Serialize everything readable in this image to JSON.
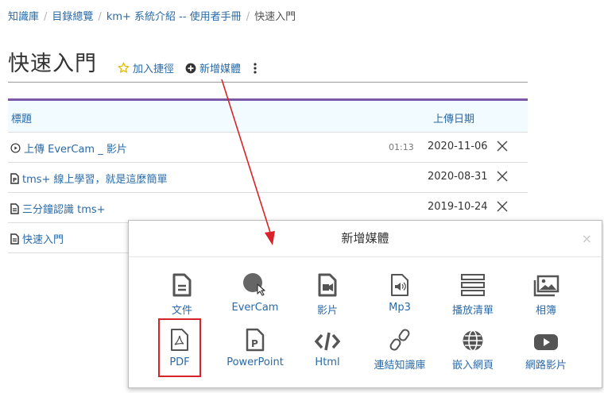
{
  "breadcrumb": {
    "items": [
      "知識庫",
      "目錄總覽",
      "km+ 系統介紹 -- 使用者手冊"
    ],
    "current": "快速入門",
    "separator": "/"
  },
  "page": {
    "title": "快速入門",
    "add_shortcut": "加入捷徑",
    "add_media": "新增媒體"
  },
  "table": {
    "headers": {
      "title": "標題",
      "date": "上傳日期"
    },
    "rows": [
      {
        "icon": "play-circle-icon",
        "title": "上傳 EverCam _ 影片",
        "duration": "01:13",
        "date": "2020-11-06"
      },
      {
        "icon": "powerpoint-file-icon",
        "title": "tms+ 線上學習，就是這麼簡單",
        "duration": "",
        "date": "2020-08-31"
      },
      {
        "icon": "document-icon",
        "title": "三分鐘認識 tms+",
        "duration": "",
        "date": "2019-10-24"
      },
      {
        "icon": "document-icon",
        "title": "快速入門",
        "duration": "",
        "date": ""
      }
    ]
  },
  "modal": {
    "title": "新增媒體",
    "close": "×",
    "items": [
      {
        "id": "doc",
        "label": "文件",
        "icon": "document-icon"
      },
      {
        "id": "evercam",
        "label": "EverCam",
        "icon": "evercam-icon"
      },
      {
        "id": "video",
        "label": "影片",
        "icon": "video-file-icon"
      },
      {
        "id": "mp3",
        "label": "Mp3",
        "icon": "audio-file-icon"
      },
      {
        "id": "playlist",
        "label": "播放清單",
        "icon": "playlist-icon"
      },
      {
        "id": "album",
        "label": "相簿",
        "icon": "album-icon"
      },
      {
        "id": "pdf",
        "label": "PDF",
        "icon": "pdf-icon"
      },
      {
        "id": "ppt",
        "label": "PowerPoint",
        "icon": "powerpoint-icon"
      },
      {
        "id": "html",
        "label": "Html",
        "icon": "code-icon"
      },
      {
        "id": "kblink",
        "label": "連結知識庫",
        "icon": "link-icon"
      },
      {
        "id": "embed",
        "label": "嵌入網頁",
        "icon": "globe-icon"
      },
      {
        "id": "webvideo",
        "label": "網路影片",
        "icon": "youtube-icon"
      }
    ]
  },
  "colors": {
    "link": "#2a6aa8",
    "header_bar": "#7a5aa8",
    "highlight": "#d9232a"
  }
}
